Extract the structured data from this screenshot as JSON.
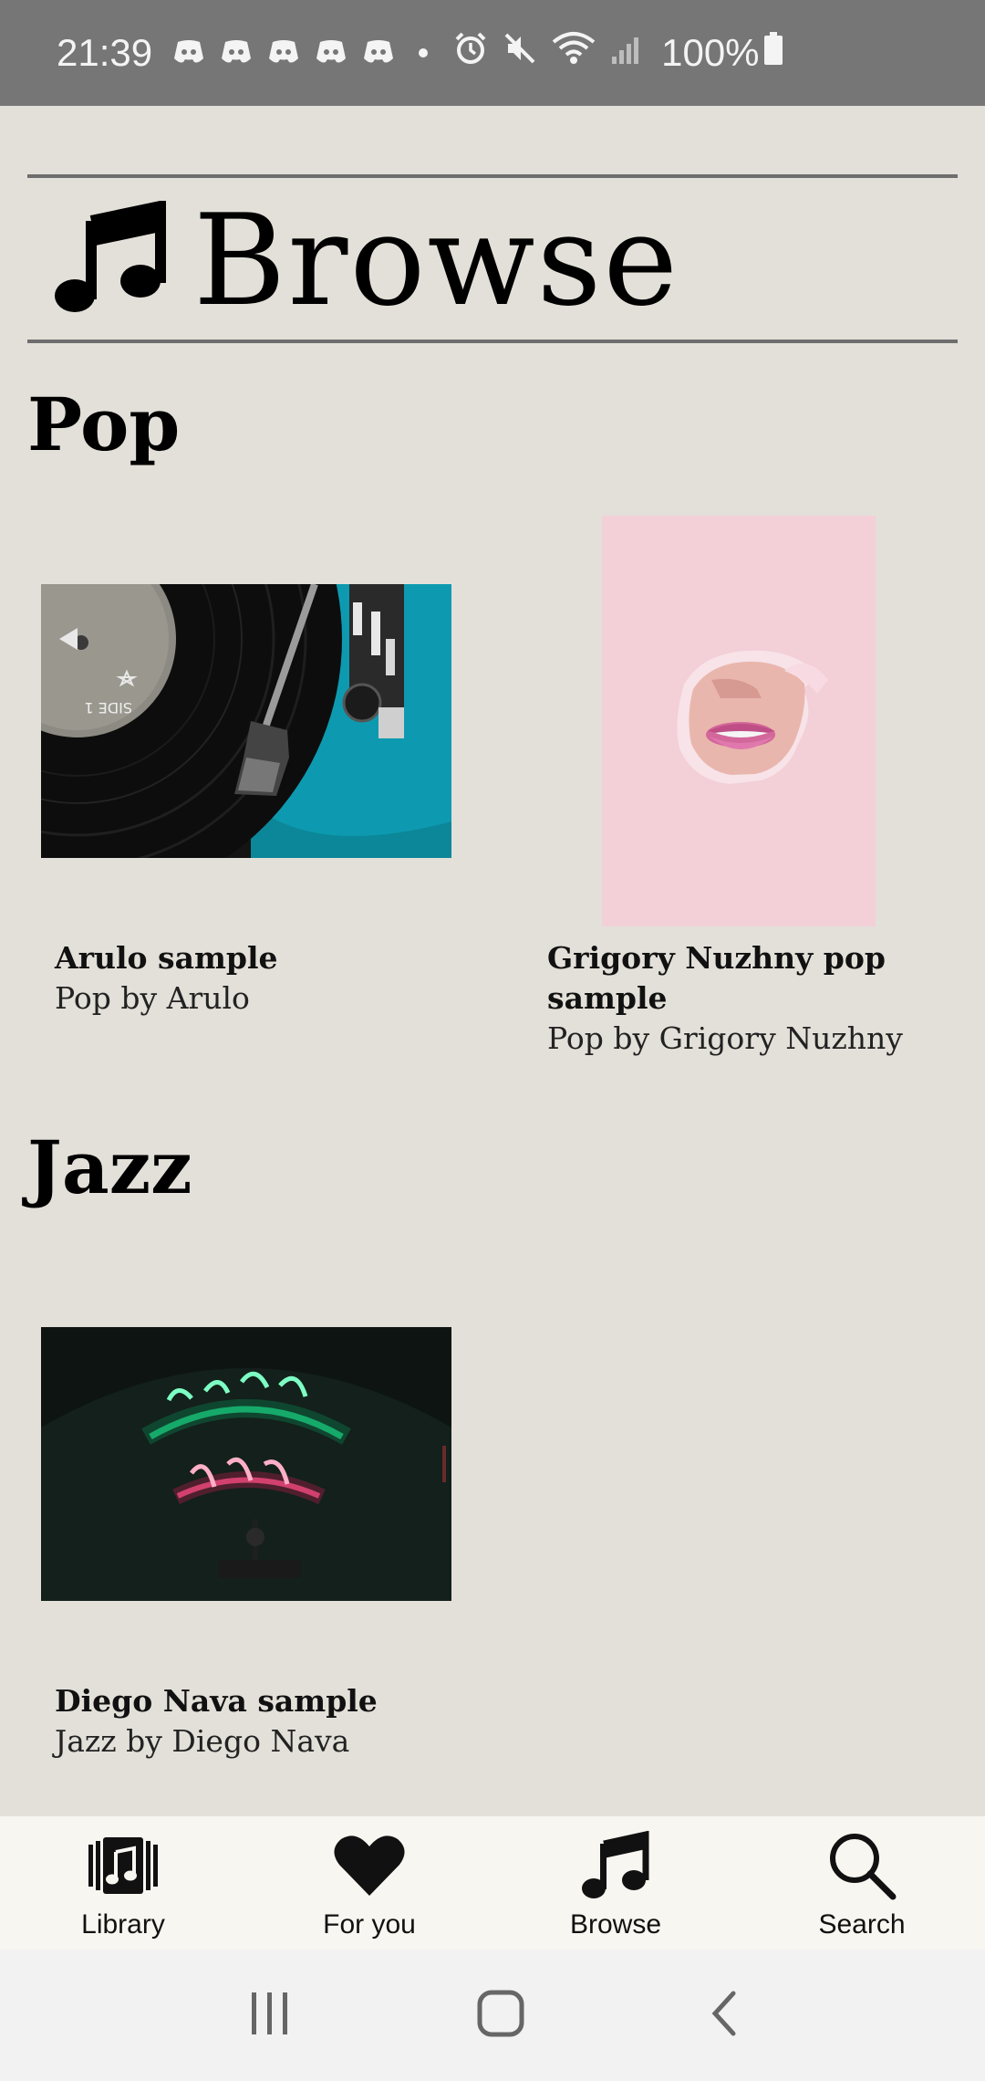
{
  "status_bar": {
    "time": "21:39",
    "notification_icons": [
      "discord-icon",
      "discord-icon",
      "discord-icon",
      "discord-icon",
      "discord-icon"
    ],
    "system_icons": [
      "alarm-icon",
      "mute-icon",
      "wifi-icon",
      "signal-icon"
    ],
    "battery": "100%"
  },
  "header": {
    "icon": "music-note-icon",
    "title": "Browse"
  },
  "sections": [
    {
      "title": "Pop",
      "items": [
        {
          "title": "Arulo sample",
          "subtitle": "Pop by Arulo",
          "image": "vinyl-turntable-image"
        },
        {
          "title_line1": "Grigory Nuzhny pop",
          "title_line2": "sample",
          "subtitle": "Pop by Grigory Nuzhny",
          "image": "pink-lips-image"
        }
      ]
    },
    {
      "title": "Jazz",
      "items": [
        {
          "title": "Diego Nava sample",
          "subtitle": "Jazz by Diego Nava",
          "image": "neon-jazz-club-image"
        }
      ]
    }
  ],
  "bottom_nav": [
    {
      "label": "Library",
      "icon": "library-icon"
    },
    {
      "label": "For you",
      "icon": "heart-icon"
    },
    {
      "label": "Browse",
      "icon": "music-note-icon"
    },
    {
      "label": "Search",
      "icon": "search-icon"
    }
  ],
  "system_nav": [
    "recents-icon",
    "home-icon",
    "back-icon"
  ],
  "colors": {
    "background": "#e3e0d9",
    "status_bar": "#767676",
    "bottom_nav": "#f8f6f0",
    "system_nav": "#f2f2f2"
  }
}
